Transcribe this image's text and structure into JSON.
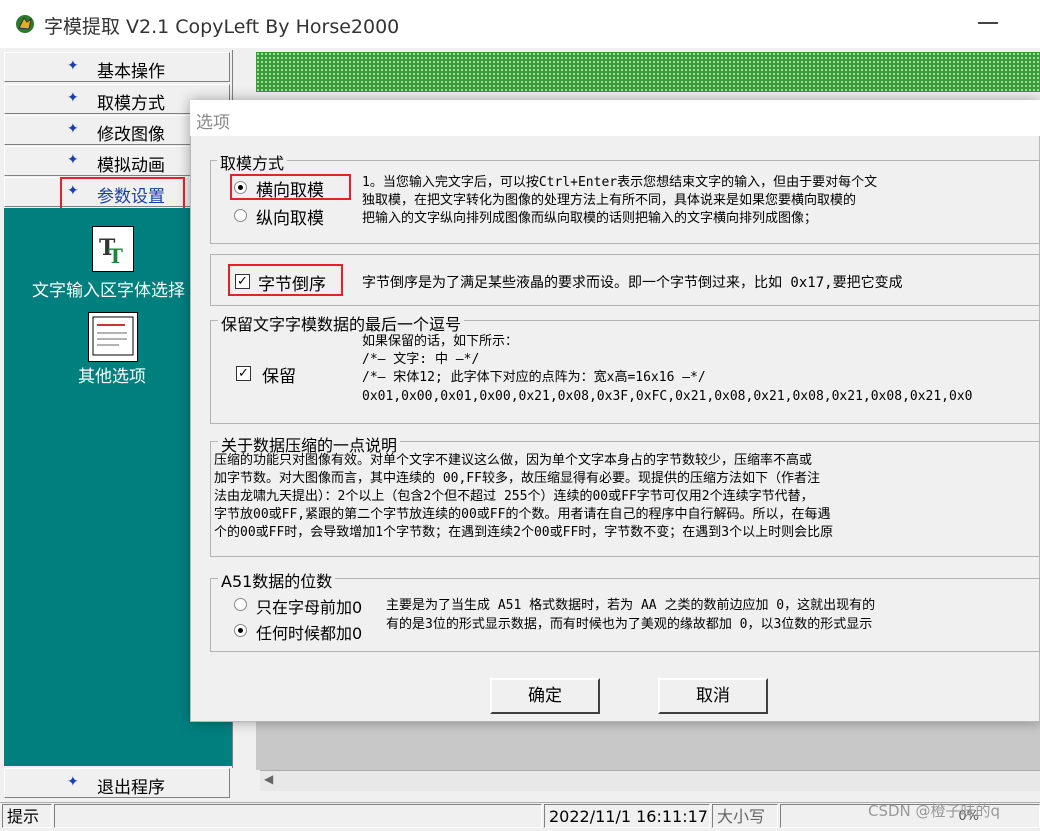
{
  "window": {
    "title": "字模提取 V2.1  CopyLeft By Horse2000"
  },
  "nav": {
    "items": [
      {
        "label": "基本操作"
      },
      {
        "label": "取模方式"
      },
      {
        "label": "修改图像"
      },
      {
        "label": "模拟动画"
      },
      {
        "label": "参数设置"
      }
    ],
    "tools": [
      {
        "label": "文字输入区字体选择",
        "icon": "font-tt-icon"
      },
      {
        "label": "其他选项",
        "icon": "options-doc-icon"
      }
    ],
    "exit_label": "退出程序"
  },
  "status": {
    "hint": "提示",
    "datetime": "2022/11/1 16:11:17",
    "caps": "大小写",
    "extra": "0%"
  },
  "watermark": "CSDN @橙子味的q",
  "dialog": {
    "title": "选项",
    "group_mode": {
      "title": "取模方式",
      "options": [
        {
          "label": "横向取模",
          "selected": true
        },
        {
          "label": "纵向取模",
          "selected": false
        }
      ],
      "desc": [
        "1。当您输入完文字后，可以按Ctrl+Enter表示您想结束文字的输入，但由于要对每个文",
        "独取模，在把文字转化为图像的处理方法上有所不同，具体说来是如果您要横向取模的",
        "把输入的文字纵向排列成图像而纵向取模的话则把输入的文字横向排列成图像；"
      ]
    },
    "byte_reverse": {
      "label": "字节倒序",
      "checked": true,
      "desc": "字节倒序是为了满足某些液晶的要求而设。即一个字节倒过来，比如 0x17,要把它变成"
    },
    "keep_comma": {
      "title": "保留文字字模数据的最后一个逗号",
      "label": "保留",
      "checked": true,
      "desc": [
        "如果保留的话，如下所示：",
        "/*—   文字:  中  —*/",
        "/*—  宋体12;  此字体下对应的点阵为：宽x高=16x16   —*/",
        "0x01,0x00,0x01,0x00,0x21,0x08,0x3F,0xFC,0x21,0x08,0x21,0x08,0x21,0x08,0x21,0x0"
      ]
    },
    "compression": {
      "title": "关于数据压缩的一点说明",
      "lines": [
        "压缩的功能只对图像有效。对单个文字不建议这么做，因为单个文字本身占的字节数较少，压缩率不高或",
        "加字节数。对大图像而言，其中连续的 00,FF较多，故压缩显得有必要。现提供的压缩方法如下（作者注",
        "法由龙啸九天提出）：2个以上（包含2个但不超过 255个）连续的00或FF字节可仅用2个连续字节代替，",
        "字节放00或FF,紧跟的第二个字节放连续的00或FF的个数。用者请在自己的程序中自行解码。所以，在每遇",
        "个的00或FF时，会导致增加1个字节数；在遇到连续2个00或FF时，字节数不变；在遇到3个以上时则会比原"
      ]
    },
    "a51": {
      "title": "A51数据的位数",
      "options": [
        {
          "label": "只在字母前加0",
          "selected": false
        },
        {
          "label": "任何时候都加0",
          "selected": true
        }
      ],
      "desc": [
        "主要是为了当生成 A51 格式数据时，若为 AA 之类的数前边应加 0，这就出现有的",
        "有的是3位的形式显示数据，而有时候也为了美观的缘故都加 0，以3位数的形式显示"
      ]
    },
    "ok_label": "确定",
    "cancel_label": "取消"
  }
}
